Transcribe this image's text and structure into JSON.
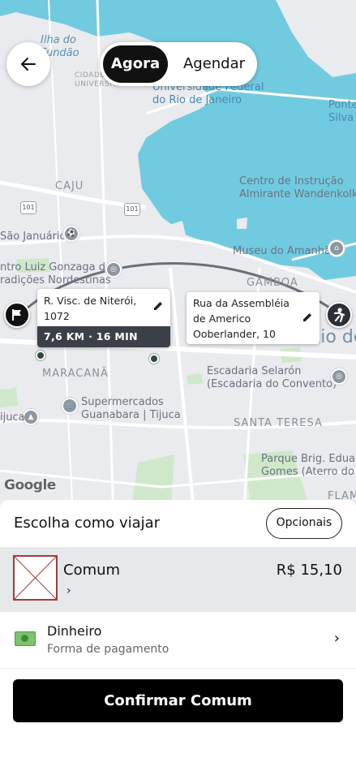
{
  "toggle": {
    "now_label": "Agora",
    "schedule_label": "Agendar"
  },
  "map": {
    "labels": {
      "ilha": "Ilha do\nFundão",
      "cidade": "CIDADE\nUNIVERSITÁRIA",
      "ufrj": "Universidade Federal\ndo Rio de Janeiro",
      "ponte": "Ponte\nSilva",
      "caju": "CAJU",
      "centro_instrucao": "Centro de Instrução\nAlmirante Wandenkolk",
      "sao_januario": "São Januário",
      "luiz_gonzaga": "ntro Luiz Gonzaga de\nradições Nordestinas",
      "museu_amanha": "Museu do Amanhã",
      "gamboa": "GAMBOA",
      "rio": "Rio de",
      "maracana": "MARACANÃ",
      "escadaria": "Escadaria Selarón\n(Escadaria do Convento)",
      "supermercados": "Supermercados\nGuanabara | Tijuca",
      "tijuca": "ijuca",
      "santa_teresa": "SANTA TERESA",
      "parque": "Parque Brig. Eduard\nGomes (Aterro do",
      "flam": "FLAM",
      "hwy1": "101",
      "hwy2": "101"
    },
    "google": "Google"
  },
  "origin": {
    "address": "R. Visc. de Niterói, 1072",
    "eta": "7,6 KM · 16 MIN"
  },
  "destination": {
    "address": "Rua da Assembléia de Americo Ooberlander, 10"
  },
  "sheet": {
    "title": "Escolha como viajar",
    "optional_label": "Opcionais",
    "ride": {
      "name": "Comum",
      "price": "R$ 15,10",
      "chevron": "›"
    },
    "payment": {
      "name": "Dinheiro",
      "subtitle": "Forma de pagamento",
      "chevron": "›"
    },
    "confirm_label": "Confirmar Comum"
  },
  "colors": {
    "water": "#71cbe0",
    "land": "#e9ebee",
    "park": "#cfe8c9",
    "primary": "#000000",
    "route": "#6b6f76"
  }
}
